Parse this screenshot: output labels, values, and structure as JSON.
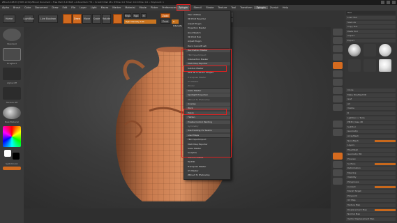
{
  "window": {
    "title": "ZBrush 4R8 P2 [HDH-1234] ZBrush Document   • Free Mem 5.433GB • Active Mem 774 • Scratch Disk 48 • RTime: 0.0 Timer: 0.0 ATime: 0.0 • PolyCount: 1"
  },
  "menubar": {
    "items": [
      "Alpha",
      "Brush",
      "Color",
      "Document",
      "Draw",
      "Edit",
      "File",
      "Layer",
      "Light",
      "Macro",
      "Marker",
      "Material",
      "Movie",
      "Picker",
      "Preferences",
      "Render",
      "Stencil",
      "Stroke",
      "Texture",
      "Tool",
      "Transform",
      "Zplugin",
      "Zscript",
      "Help"
    ],
    "active": "Zplugin",
    "active_label": "Zplugin"
  },
  "toolbar": {
    "home_label": "Home",
    "lightbox_label": "LightBox",
    "liveboolean_label": "Live Boolean",
    "draw_label": "Draw",
    "move_label": "Move",
    "scale_label": "Scale",
    "rotate_label": "Rotate",
    "mrgb_label": "Mrgb",
    "rgb_label": "Rgb",
    "m_label": "M",
    "zadd_label": "Zadd",
    "zsub_label": "Zsub",
    "focal_label": "Focal Shift 0",
    "draw_size_label": "Draw Size 64",
    "z_intensity_label": "Z Intensity 25",
    "rgb_intensity_label": "Rgb Intensity 100"
  },
  "leftbar": {
    "labels": [
      "Standard",
      "DragRect",
      "Alpha Off",
      "Texture Off",
      "BasicMaterial"
    ],
    "switch_color": "SwitchColor",
    "gradient": "Gradient"
  },
  "dropdown": {
    "items": [
      {
        "label": "Misc Utilities",
        "kind": "text"
      },
      {
        "label": "3D Print Exporter",
        "kind": "text"
      },
      {
        "label": "Adjust Plugin",
        "kind": "text"
      },
      {
        "label": "Projection Master",
        "kind": "text"
      },
      {
        "label": "QuickSketch",
        "kind": "text"
      },
      {
        "label": "3D Print Hub",
        "kind": "text"
      },
      {
        "label": "Adjust Plugin",
        "kind": "text"
      },
      {
        "label": "Deco Curve Brush",
        "kind": "text"
      },
      {
        "label": "Decimation Master",
        "kind": "btn"
      },
      {
        "label": "FBX ExportImport",
        "kind": "dim"
      },
      {
        "label": "Intersection Masker",
        "kind": "text"
      },
      {
        "label": "Multi Map Exporter",
        "kind": "btn"
      },
      {
        "label": "Subtool Master",
        "kind": "text"
      },
      {
        "label": "Text 3D & Vector Shapes",
        "kind": "text"
      },
      {
        "label": "Transpose Master",
        "kind": "dim"
      },
      {
        "label": "UV Master",
        "kind": "dim"
      },
      {
        "label": "ZColor",
        "kind": "dim"
      },
      {
        "label": "Scale Master",
        "kind": "btn"
      },
      {
        "label": "Spotlight Projection",
        "kind": "btn"
      },
      {
        "label": "ZBrush To Photoshop",
        "kind": "dim"
      },
      {
        "label": "Unwrap",
        "kind": "btn"
      },
      {
        "label": "Work",
        "kind": "btn"
      },
      {
        "label": "Polish",
        "kind": "btn"
      },
      {
        "label": "Flatten",
        "kind": "btn"
      },
      {
        "label": "Enable Control Painting",
        "kind": "btn"
      },
      {
        "label": "Symmetry",
        "kind": "dim"
      },
      {
        "label": "Use Existing UV Seams",
        "kind": "btn"
      },
      {
        "label": "Load Maps",
        "kind": "btn"
      },
      {
        "label": "FBX ExportImport",
        "kind": "text"
      },
      {
        "label": "Multi Map Exporter",
        "kind": "text"
      },
      {
        "label": "Scale Master",
        "kind": "text"
      },
      {
        "label": "Sculptris",
        "kind": "text"
      },
      {
        "label": "SubTool Master",
        "kind": "text"
      },
      {
        "label": "Text3D",
        "kind": "text"
      },
      {
        "label": "Transpose Master",
        "kind": "text"
      },
      {
        "label": "UV Master",
        "kind": "text"
      },
      {
        "label": "ZBrush To Photoshop",
        "kind": "text"
      }
    ]
  },
  "rightpanel": {
    "title": "Tool",
    "rows": [
      "Load Tool",
      "Save As",
      "Copy Tool",
      "Paste Tool",
      "Import",
      "Export",
      "Clone",
      "Make PolyMesh3D",
      "GoZ",
      "All",
      "Visible",
      "R",
      "Lightbox > Tools",
      "PM3D_Vase 48",
      "SubTool",
      "Geometry",
      "ArrayMesh",
      "NanoMesh",
      "Layers",
      "FiberMesh",
      "Geometry HD",
      "Preview",
      "Surface",
      "Deformation",
      "Masking",
      "Visibility",
      "Polygroups",
      "Contact",
      "Morph Target",
      "Polypaint",
      "UV Map",
      "Texture Map",
      "Displacement Map",
      "Normal Map",
      "Vector Displacement Map",
      "Display Properties",
      "Unified Skin",
      "Initialize",
      "Import",
      "Export"
    ]
  },
  "colors": {
    "accent": "#d06a1f",
    "highlight": "#e02020",
    "vase": "#c97b4e"
  }
}
